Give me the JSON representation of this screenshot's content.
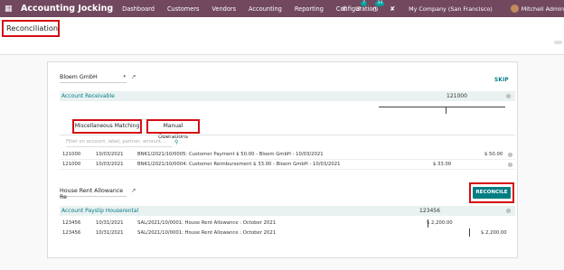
{
  "navbar": {
    "brand": "Accounting Jocking",
    "menu": [
      "Dashboard",
      "Customers",
      "Vendors",
      "Accounting",
      "Reporting",
      "Configuration"
    ],
    "messages_badge": "7",
    "activities_badge": "34",
    "company": "My Company (San Francisco)",
    "user": "Mitchell Admin"
  },
  "page": {
    "title": "Reconciliation"
  },
  "block1": {
    "partner": "Bloem GmbH",
    "skip": "SKIP",
    "account": "Account Receivable",
    "amount": "121000",
    "info": "i"
  },
  "tabs": {
    "misc": "Miscellaneous Matching",
    "manual": "Manual Operations"
  },
  "search": {
    "placeholder": "Filter on account, label, partner, amount,..."
  },
  "lines1": [
    {
      "acct": "121000",
      "date": "10/03/2021",
      "label": "BNK1/2021/10/0005: Customer Payment $ 50.00 - Bloem GmbH - 10/03/2021",
      "debit": "",
      "credit": "$ 50.00"
    },
    {
      "acct": "121000",
      "date": "10/03/2021",
      "label": "BNK1/2021/10/0004: Customer Reimbursement $ 33.00 - Bloem GmbH - 10/03/2021",
      "debit": "$ 33.00",
      "credit": ""
    }
  ],
  "block2": {
    "partner": "House Rent Allowance Re",
    "reconcile": "RECONCILE",
    "account": "Account Payslip Houserental",
    "amount": "123456",
    "info": "i"
  },
  "lines2": [
    {
      "acct": "123456",
      "date": "10/31/2021",
      "label": "SAL/2021/10/0001: House Rent Allowance : October 2021",
      "debit": "$ 2,200.00",
      "credit": ""
    },
    {
      "acct": "123456",
      "date": "10/31/2021",
      "label": "SAL/2021/10/0001: House Rent Allowance : October 2021",
      "debit": "",
      "credit": "$ 2,200.00"
    }
  ],
  "colors": {
    "navbar": "#71485e",
    "accent": "#017e84",
    "highlight": "#d40c14"
  }
}
